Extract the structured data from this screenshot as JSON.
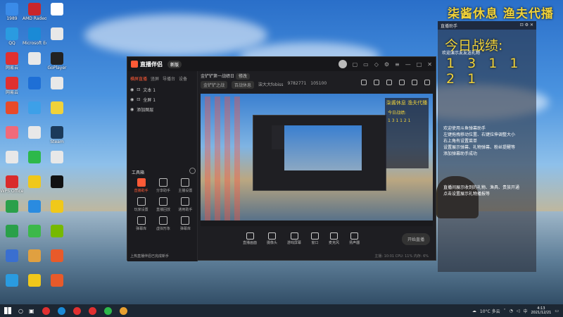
{
  "overlay_title": "柒酱休息 渔夫代播",
  "desktop_icons": [
    {
      "label": "1989",
      "color": "#3a8be8"
    },
    {
      "label": "AMD Radeon Software",
      "color": "#c8262c"
    },
    {
      "label": "",
      "color": "#ffffff"
    },
    {
      "label": "QQ",
      "color": "#2a9be0"
    },
    {
      "label": "Microsoft Edge",
      "color": "#1a8ad6"
    },
    {
      "label": "",
      "color": "#e8e8e8"
    },
    {
      "label": "网易云",
      "color": "#e03030"
    },
    {
      "label": "",
      "color": "#e8e8e8"
    },
    {
      "label": "GoPlayer",
      "color": "#222222"
    },
    {
      "label": "网易云",
      "color": "#e03030"
    },
    {
      "label": "",
      "color": "#1e6fd6"
    },
    {
      "label": "",
      "color": "#e8e8e8"
    },
    {
      "label": "",
      "color": "#e74a2a"
    },
    {
      "label": "",
      "color": "#3da0e8"
    },
    {
      "label": "",
      "color": "#f0d23a"
    },
    {
      "label": "",
      "color": "#f06a7a"
    },
    {
      "label": "",
      "color": "#e8e8e8"
    },
    {
      "label": "Steam",
      "color": "#1b3a5a"
    },
    {
      "label": "",
      "color": "#e8e8e8"
    },
    {
      "label": "",
      "color": "#2db84a"
    },
    {
      "label": "",
      "color": "#e8e8e8"
    },
    {
      "label": "WPS Office",
      "color": "#d92b2b"
    },
    {
      "label": "",
      "color": "#f0c81a"
    },
    {
      "label": "",
      "color": "#111111"
    },
    {
      "label": "",
      "color": "#2aa04a"
    },
    {
      "label": "",
      "color": "#2a8be0"
    },
    {
      "label": "",
      "color": "#f0c81a"
    },
    {
      "label": "",
      "color": "#2aa04a"
    },
    {
      "label": "",
      "color": "#3cb84a"
    },
    {
      "label": "",
      "color": "#76b900"
    },
    {
      "label": "",
      "color": "#3a6fd0"
    },
    {
      "label": "",
      "color": "#e0a040"
    },
    {
      "label": "",
      "color": "#e85a2a"
    },
    {
      "label": "",
      "color": "#2a9be0"
    },
    {
      "label": "",
      "color": "#f0c81a"
    },
    {
      "label": "",
      "color": "#e85a2a"
    }
  ],
  "app": {
    "name": "直播伴侣",
    "version": "新版",
    "tabs": [
      "横屏直播",
      "竖屏",
      "导播台",
      "设备"
    ],
    "scenes": [
      "文本 1",
      "全屏 1",
      "添加图层"
    ],
    "tools_header": "工具箱",
    "tools": [
      {
        "label": "直播助手",
        "hot": true
      },
      {
        "label": "分享助手",
        "hot": false
      },
      {
        "label": "主播设置",
        "hot": false
      },
      {
        "label": "玩家设置",
        "hot": false
      },
      {
        "label": "直播回放",
        "hot": false
      },
      {
        "label": "通用助手",
        "hot": false
      },
      {
        "label": "弹幕库",
        "hot": false
      },
      {
        "label": "虚拟形象",
        "hot": false
      },
      {
        "label": "弹幕库",
        "hot": false
      }
    ],
    "tip": "上热直播伴侣已完成新手",
    "stage_title": "金铲铲第一战绩日",
    "stage_badge": "修改",
    "stage_row2": [
      "金铲铲之战",
      "百战休息",
      "柒大大fobiss",
      "9782771",
      "105100"
    ],
    "preview_overlay_title": "柒酱休息 渔夫代播",
    "preview_overlay_sub": "今日战绩:",
    "preview_overlay_nums": "1 3 1 1 2 1",
    "controls": [
      "直播画面",
      "摄像头",
      "游戏屏幕",
      "窗口",
      "麦克风",
      "扬声器"
    ],
    "start_label": "开始直播",
    "status": "主播: 10:01  CPU: 11%  内存: 6%"
  },
  "panel": {
    "header": "直播助手",
    "record_title": "今日战绩:",
    "record_nums": "1 3 1 1 2 1",
    "sub": "欢迎演示友友送礼物",
    "msgs": [
      "欢迎使用斗鱼弹幕助手",
      "左键拖拽移动位置、右键拉伸调整大小",
      "右上角有设置菜单",
      "设置展示弹幕、礼物弹幕、粉丝提醒等",
      "添加弹幕助手成功"
    ],
    "msgs2": [
      "直播间展示收到的礼物、渔具、贵族开通",
      "点击设置展示礼物播报等"
    ]
  },
  "taskbar": {
    "weather": "10°C 多云",
    "time": "4:13",
    "date": "2021/12/21",
    "apps": [
      "#e03030",
      "#1a8ad6",
      "#e03030",
      "#e03030",
      "#2db84a",
      "#e8a030"
    ]
  }
}
